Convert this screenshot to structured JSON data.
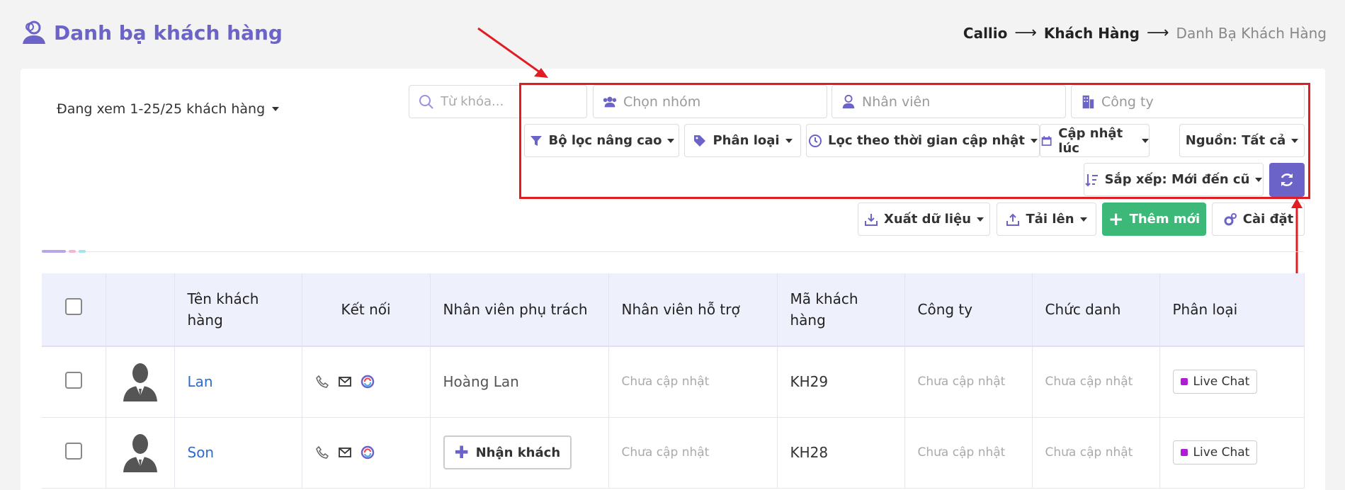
{
  "header": {
    "title": "Danh bạ khách hàng",
    "breadcrumb": [
      "Callio",
      "Khách Hàng",
      "Danh Bạ Khách Hàng"
    ]
  },
  "toolbar": {
    "viewing_text": "Đang xem 1-25/25 khách hàng",
    "search_placeholder": "Từ khóa...",
    "group_placeholder": "Chọn nhóm",
    "staff_placeholder": "Nhân viên",
    "company_placeholder": "Công ty",
    "advanced_filter": "Bộ lọc nâng cao",
    "classify": "Phân loại",
    "time_filter": "Lọc theo thời gian cập nhật",
    "updated_at": "Cập nhật lúc",
    "source": "Nguồn: Tất cả",
    "sort": "Sắp xếp: Mới đến cũ",
    "export": "Xuất dữ liệu",
    "upload": "Tải lên",
    "add_new": "Thêm mới",
    "settings": "Cài đặt"
  },
  "table": {
    "columns": [
      "Tên khách hàng",
      "Kết nối",
      "Nhân viên phụ trách",
      "Nhân viên hỗ trợ",
      "Mã khách hàng",
      "Công ty",
      "Chức danh",
      "Phân loại"
    ],
    "rows": [
      {
        "name": "Lan",
        "owner": "Hoàng Lan",
        "support": "Chưa cập nhật",
        "code": "KH29",
        "company": "Chưa cập nhật",
        "title": "Chưa cập nhật",
        "tag": "Live Chat"
      },
      {
        "name": "Son",
        "owner_button": "Nhận khách",
        "support": "Chưa cập nhật",
        "code": "KH28",
        "company": "Chưa cập nhật",
        "title": "Chưa cập nhật",
        "tag": "Live Chat"
      }
    ]
  },
  "colors": {
    "accent": "#6c63c8",
    "primary_green": "#3cb878",
    "link": "#2c6bd4",
    "annotation_red": "#e11d24",
    "tag_livechat": "#b01bd6"
  },
  "progress_segments": [
    "#b9a6e8",
    "#f5b6d6",
    "#a6e3f0"
  ]
}
